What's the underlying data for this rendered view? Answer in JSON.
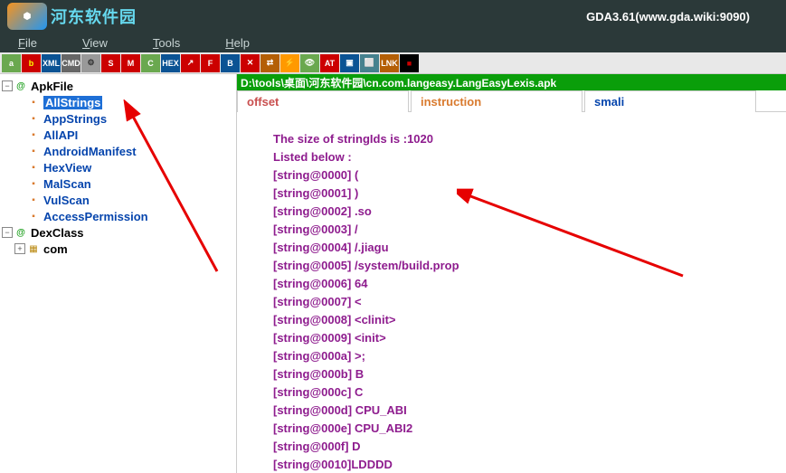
{
  "title": "GDA3.61(www.gda.wiki:9090)",
  "logo_text": "河东软件园",
  "menu": [
    "File",
    "View",
    "Tools",
    "Help"
  ],
  "toolbar": [
    {
      "t": "a",
      "bg": "#6aa84f",
      "fg": "#fff"
    },
    {
      "t": "b",
      "bg": "#cc0000",
      "fg": "#ff0"
    },
    {
      "t": "XML",
      "bg": "#0b5394",
      "fg": "#fff"
    },
    {
      "t": "CMD",
      "bg": "#666",
      "fg": "#fff"
    },
    {
      "t": "⚙",
      "bg": "#999",
      "fg": "#333"
    },
    {
      "t": "S",
      "bg": "#cc0000",
      "fg": "#fff"
    },
    {
      "t": "M",
      "bg": "#cc0000",
      "fg": "#fff"
    },
    {
      "t": "C",
      "bg": "#6aa84f",
      "fg": "#fff"
    },
    {
      "t": "HEX",
      "bg": "#0b5394",
      "fg": "#fff"
    },
    {
      "t": "↗",
      "bg": "#cc0000",
      "fg": "#fff"
    },
    {
      "t": "F",
      "bg": "#cc0000",
      "fg": "#fff"
    },
    {
      "t": "B",
      "bg": "#0b5394",
      "fg": "#fff"
    },
    {
      "t": "✕",
      "bg": "#cc0000",
      "fg": "#fff"
    },
    {
      "t": "⇄",
      "bg": "#b45f06",
      "fg": "#fff"
    },
    {
      "t": "⚡",
      "bg": "#ff9900",
      "fg": "#fff"
    },
    {
      "t": "👁",
      "bg": "#6aa84f",
      "fg": "#fff"
    },
    {
      "t": "AT",
      "bg": "#cc0000",
      "fg": "#fff"
    },
    {
      "t": "▣",
      "bg": "#0b5394",
      "fg": "#fff"
    },
    {
      "t": "⬜",
      "bg": "#45818e",
      "fg": "#fff"
    },
    {
      "t": "LNK",
      "bg": "#b45f06",
      "fg": "#fff"
    },
    {
      "t": "■",
      "bg": "#000",
      "fg": "#cc0000"
    }
  ],
  "tree": {
    "root": "ApkFile",
    "items": [
      {
        "label": "AllStrings",
        "sel": true
      },
      {
        "label": "AppStrings"
      },
      {
        "label": "AllAPI"
      },
      {
        "label": "AndroidManifest"
      },
      {
        "label": "HexView"
      },
      {
        "label": "MalScan"
      },
      {
        "label": "VulScan"
      },
      {
        "label": "AccessPermission"
      }
    ],
    "dex": "DexClass",
    "com": "com"
  },
  "path": "D:\\tools\\桌面\\河东软件园\\cn.com.langeasy.LangEasyLexis.apk",
  "tabs": {
    "offset": "offset",
    "instruction": "instruction",
    "smali": "smali"
  },
  "listing": [
    "The size of stringIds is :1020",
    "Listed below :",
    "[string@0000] (",
    "[string@0001] )",
    "[string@0002] .so",
    "[string@0003] /",
    "[string@0004] /.jiagu",
    "[string@0005] /system/build.prop",
    "[string@0006] 64",
    "[string@0007] <",
    "[string@0008] <clinit>",
    "[string@0009] <init>",
    "[string@000a] >;",
    "[string@000b] B",
    "[string@000c] C",
    "[string@000d] CPU_ABI",
    "[string@000e] CPU_ABI2",
    "[string@000f] D",
    "[string@0010]LDDDD"
  ]
}
